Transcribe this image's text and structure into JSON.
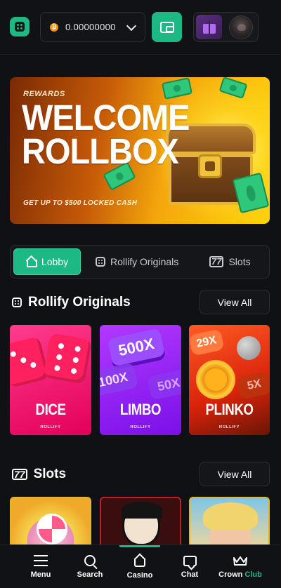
{
  "header": {
    "balance": "0.00000000",
    "coin_symbol": "₿",
    "icons": [
      "logo-icon",
      "bitcoin-icon",
      "chevron-down-icon",
      "wallet-icon",
      "gift-icon",
      "avatar"
    ]
  },
  "banner": {
    "tag": "REWARDS",
    "title_line1": "WELCOME",
    "title_line2": "ROLLBOX",
    "subtitle": "GET UP TO $500 LOCKED CASH"
  },
  "tabs": [
    {
      "label": "Lobby",
      "icon": "home-icon",
      "active": true
    },
    {
      "label": "Rollify Originals",
      "icon": "dice-icon",
      "active": false
    },
    {
      "label": "Slots",
      "icon": "slot-icon",
      "active": false
    }
  ],
  "originals": {
    "title": "Rollify Originals",
    "view_all": "View All",
    "games": [
      {
        "name": "DICE",
        "brand": "ROLLIFY"
      },
      {
        "name": "LIMBO",
        "brand": "ROLLIFY",
        "chips": [
          "500X",
          "100X",
          "50X"
        ]
      },
      {
        "name": "PLINKO",
        "brand": "ROLLIFY",
        "chips": [
          "29X",
          "5X"
        ]
      }
    ]
  },
  "slots": {
    "title": "Slots",
    "view_all": "View All"
  },
  "bottom_nav": [
    {
      "label": "Menu",
      "icon": "menu-icon"
    },
    {
      "label": "Search",
      "icon": "search-icon"
    },
    {
      "label": "Casino",
      "icon": "casino-icon",
      "active": true
    },
    {
      "label": "Chat",
      "icon": "chat-icon"
    },
    {
      "label_a": "Crown",
      "label_b": "Club",
      "icon": "crown-icon"
    }
  ],
  "colors": {
    "accent": "#1db984",
    "background": "#101114",
    "dice": "#e3005a",
    "limbo": "#7a10e8",
    "plinko": "#d9230a"
  }
}
